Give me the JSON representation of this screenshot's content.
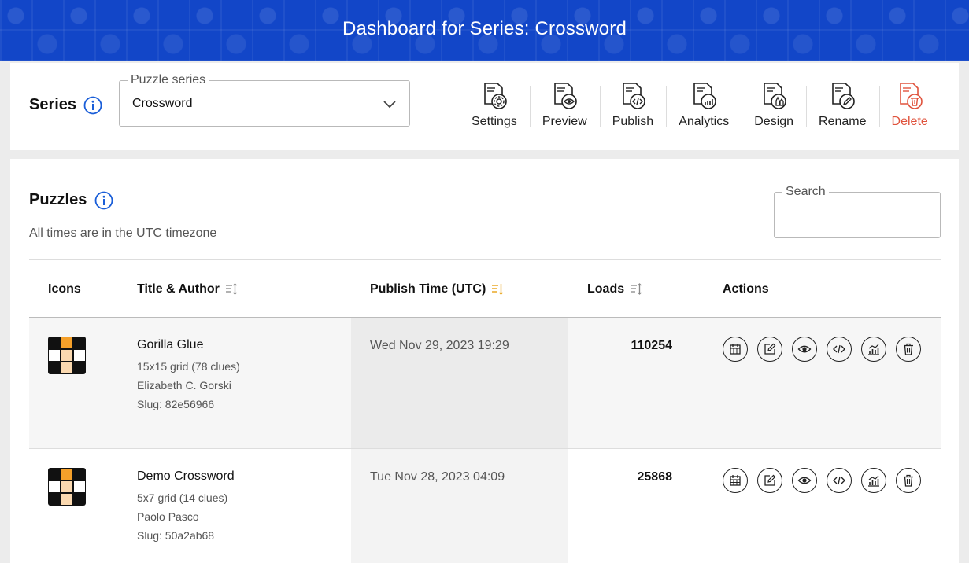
{
  "header": {
    "title": "Dashboard for Series: Crossword"
  },
  "series": {
    "label": "Series",
    "select_legend": "Puzzle series",
    "select_value": "Crossword",
    "tools": [
      {
        "name": "settings",
        "label": "Settings",
        "icon": "doc-gear-icon"
      },
      {
        "name": "preview",
        "label": "Preview",
        "icon": "doc-eye-icon"
      },
      {
        "name": "publish",
        "label": "Publish",
        "icon": "doc-code-icon"
      },
      {
        "name": "analytics",
        "label": "Analytics",
        "icon": "doc-chart-icon"
      },
      {
        "name": "design",
        "label": "Design",
        "icon": "doc-brush-icon"
      },
      {
        "name": "rename",
        "label": "Rename",
        "icon": "doc-pencil-icon"
      },
      {
        "name": "delete",
        "label": "Delete",
        "icon": "doc-trash-icon",
        "color": "#e0533d"
      }
    ]
  },
  "puzzles": {
    "title": "Puzzles",
    "timezone_note": "All times are in the UTC timezone",
    "search_legend": "Search",
    "search_value": "",
    "columns": {
      "icons": "Icons",
      "title_author": "Title & Author",
      "publish_time": "Publish Time (UTC)",
      "loads": "Loads",
      "actions": "Actions"
    },
    "rows": [
      {
        "title": "Gorilla Glue",
        "grid": "15x15 grid (78 clues)",
        "author": "Elizabeth C. Gorski",
        "slug": "Slug: 82e56966",
        "publish_time": "Wed Nov 29, 2023 19:29",
        "loads": "110254"
      },
      {
        "title": "Demo Crossword",
        "grid": "5x7 grid (14 clues)",
        "author": "Paolo Pasco",
        "slug": "Slug: 50a2ab68",
        "publish_time": "Tue Nov 28, 2023 04:09",
        "loads": "25868"
      }
    ],
    "row_actions": [
      "calendar-icon",
      "edit-icon",
      "eye-icon",
      "code-icon",
      "chart-icon",
      "trash-icon"
    ]
  },
  "colors": {
    "banner": "#1246c8",
    "danger": "#e0533d",
    "accent_sort": "#e8a317",
    "thumb_orange": "#f5a02a",
    "thumb_light": "#fbd9b0"
  }
}
